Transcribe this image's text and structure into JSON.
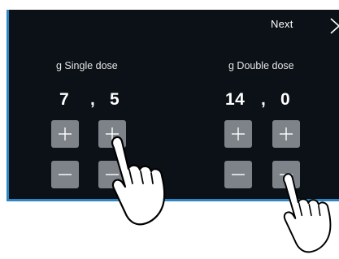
{
  "header": {
    "next_label": "Next",
    "next_icon": "chevron-right-icon"
  },
  "single": {
    "label": "g Single dose",
    "integer": "7",
    "separator": ",",
    "decimal": "5"
  },
  "double": {
    "label": "g Double dose",
    "integer": "14",
    "separator": ",",
    "decimal": "0"
  },
  "colors": {
    "screen_bg": "#0b1116",
    "screen_border": "#2d86c4",
    "button_bg": "#7e8389",
    "text": "#ffffff"
  }
}
